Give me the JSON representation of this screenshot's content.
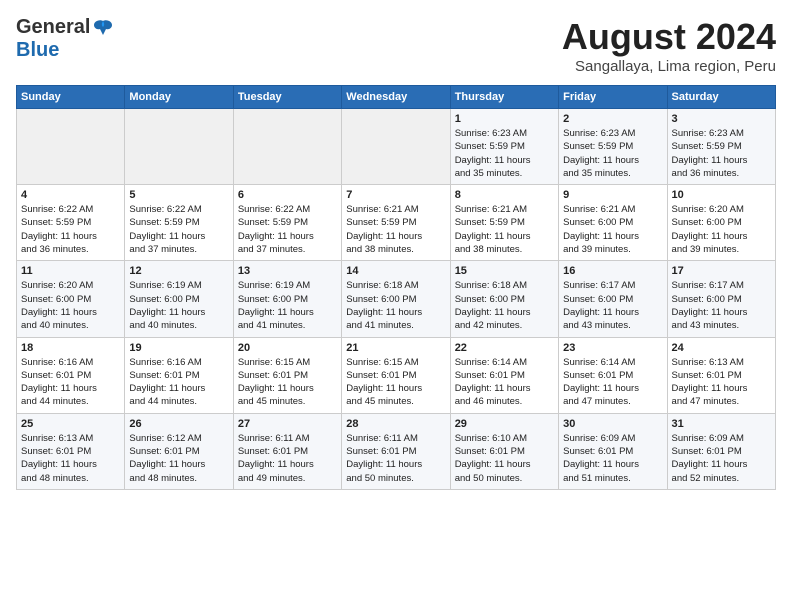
{
  "header": {
    "logo_general": "General",
    "logo_blue": "Blue",
    "month_title": "August 2024",
    "location": "Sangallaya, Lima region, Peru"
  },
  "calendar": {
    "days_of_week": [
      "Sunday",
      "Monday",
      "Tuesday",
      "Wednesday",
      "Thursday",
      "Friday",
      "Saturday"
    ],
    "weeks": [
      [
        {
          "day": "",
          "info": ""
        },
        {
          "day": "",
          "info": ""
        },
        {
          "day": "",
          "info": ""
        },
        {
          "day": "",
          "info": ""
        },
        {
          "day": "1",
          "info": "Sunrise: 6:23 AM\nSunset: 5:59 PM\nDaylight: 11 hours\nand 35 minutes."
        },
        {
          "day": "2",
          "info": "Sunrise: 6:23 AM\nSunset: 5:59 PM\nDaylight: 11 hours\nand 35 minutes."
        },
        {
          "day": "3",
          "info": "Sunrise: 6:23 AM\nSunset: 5:59 PM\nDaylight: 11 hours\nand 36 minutes."
        }
      ],
      [
        {
          "day": "4",
          "info": "Sunrise: 6:22 AM\nSunset: 5:59 PM\nDaylight: 11 hours\nand 36 minutes."
        },
        {
          "day": "5",
          "info": "Sunrise: 6:22 AM\nSunset: 5:59 PM\nDaylight: 11 hours\nand 37 minutes."
        },
        {
          "day": "6",
          "info": "Sunrise: 6:22 AM\nSunset: 5:59 PM\nDaylight: 11 hours\nand 37 minutes."
        },
        {
          "day": "7",
          "info": "Sunrise: 6:21 AM\nSunset: 5:59 PM\nDaylight: 11 hours\nand 38 minutes."
        },
        {
          "day": "8",
          "info": "Sunrise: 6:21 AM\nSunset: 5:59 PM\nDaylight: 11 hours\nand 38 minutes."
        },
        {
          "day": "9",
          "info": "Sunrise: 6:21 AM\nSunset: 6:00 PM\nDaylight: 11 hours\nand 39 minutes."
        },
        {
          "day": "10",
          "info": "Sunrise: 6:20 AM\nSunset: 6:00 PM\nDaylight: 11 hours\nand 39 minutes."
        }
      ],
      [
        {
          "day": "11",
          "info": "Sunrise: 6:20 AM\nSunset: 6:00 PM\nDaylight: 11 hours\nand 40 minutes."
        },
        {
          "day": "12",
          "info": "Sunrise: 6:19 AM\nSunset: 6:00 PM\nDaylight: 11 hours\nand 40 minutes."
        },
        {
          "day": "13",
          "info": "Sunrise: 6:19 AM\nSunset: 6:00 PM\nDaylight: 11 hours\nand 41 minutes."
        },
        {
          "day": "14",
          "info": "Sunrise: 6:18 AM\nSunset: 6:00 PM\nDaylight: 11 hours\nand 41 minutes."
        },
        {
          "day": "15",
          "info": "Sunrise: 6:18 AM\nSunset: 6:00 PM\nDaylight: 11 hours\nand 42 minutes."
        },
        {
          "day": "16",
          "info": "Sunrise: 6:17 AM\nSunset: 6:00 PM\nDaylight: 11 hours\nand 43 minutes."
        },
        {
          "day": "17",
          "info": "Sunrise: 6:17 AM\nSunset: 6:00 PM\nDaylight: 11 hours\nand 43 minutes."
        }
      ],
      [
        {
          "day": "18",
          "info": "Sunrise: 6:16 AM\nSunset: 6:01 PM\nDaylight: 11 hours\nand 44 minutes."
        },
        {
          "day": "19",
          "info": "Sunrise: 6:16 AM\nSunset: 6:01 PM\nDaylight: 11 hours\nand 44 minutes."
        },
        {
          "day": "20",
          "info": "Sunrise: 6:15 AM\nSunset: 6:01 PM\nDaylight: 11 hours\nand 45 minutes."
        },
        {
          "day": "21",
          "info": "Sunrise: 6:15 AM\nSunset: 6:01 PM\nDaylight: 11 hours\nand 45 minutes."
        },
        {
          "day": "22",
          "info": "Sunrise: 6:14 AM\nSunset: 6:01 PM\nDaylight: 11 hours\nand 46 minutes."
        },
        {
          "day": "23",
          "info": "Sunrise: 6:14 AM\nSunset: 6:01 PM\nDaylight: 11 hours\nand 47 minutes."
        },
        {
          "day": "24",
          "info": "Sunrise: 6:13 AM\nSunset: 6:01 PM\nDaylight: 11 hours\nand 47 minutes."
        }
      ],
      [
        {
          "day": "25",
          "info": "Sunrise: 6:13 AM\nSunset: 6:01 PM\nDaylight: 11 hours\nand 48 minutes."
        },
        {
          "day": "26",
          "info": "Sunrise: 6:12 AM\nSunset: 6:01 PM\nDaylight: 11 hours\nand 48 minutes."
        },
        {
          "day": "27",
          "info": "Sunrise: 6:11 AM\nSunset: 6:01 PM\nDaylight: 11 hours\nand 49 minutes."
        },
        {
          "day": "28",
          "info": "Sunrise: 6:11 AM\nSunset: 6:01 PM\nDaylight: 11 hours\nand 50 minutes."
        },
        {
          "day": "29",
          "info": "Sunrise: 6:10 AM\nSunset: 6:01 PM\nDaylight: 11 hours\nand 50 minutes."
        },
        {
          "day": "30",
          "info": "Sunrise: 6:09 AM\nSunset: 6:01 PM\nDaylight: 11 hours\nand 51 minutes."
        },
        {
          "day": "31",
          "info": "Sunrise: 6:09 AM\nSunset: 6:01 PM\nDaylight: 11 hours\nand 52 minutes."
        }
      ]
    ]
  }
}
